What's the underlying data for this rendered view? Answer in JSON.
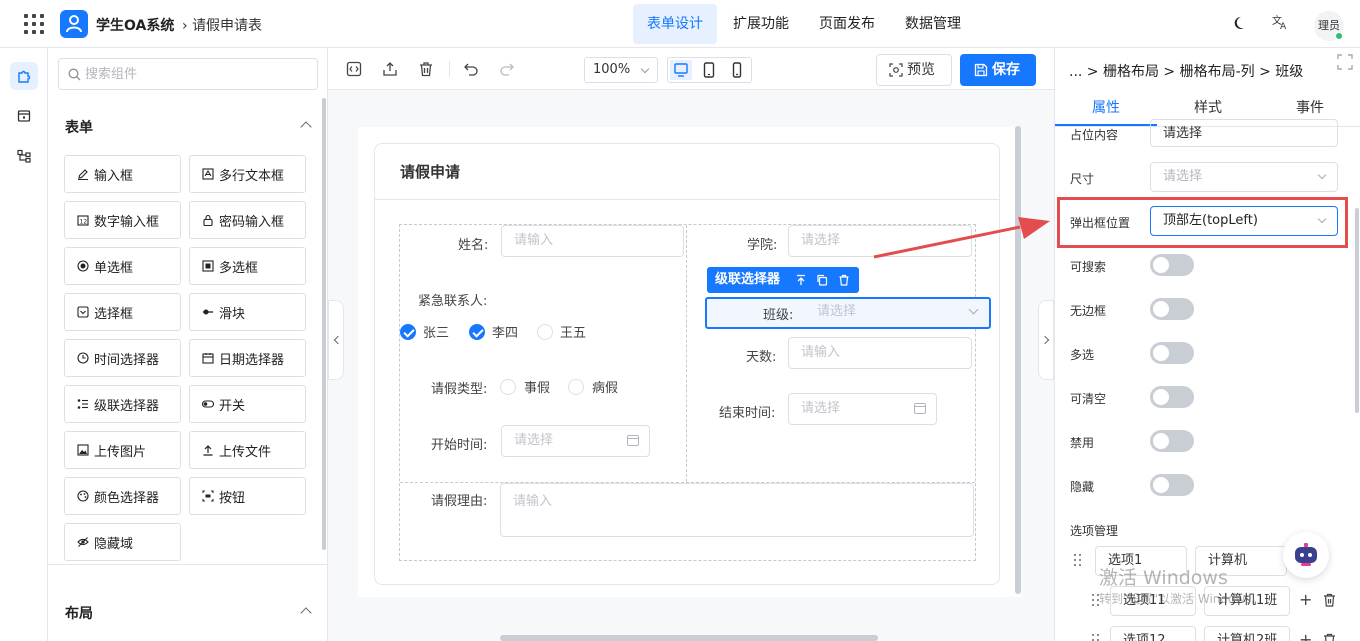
{
  "header": {
    "app_name": "学生OA系统",
    "breadcrumb": "请假申请表",
    "nav": [
      "表单设计",
      "扩展功能",
      "页面发布",
      "数据管理"
    ],
    "active_nav": "表单设计",
    "lang_icon": "文A",
    "avatar_text": "理员"
  },
  "left_rail": [
    "components",
    "form-settings",
    "tree"
  ],
  "components": {
    "search_placeholder": "搜索组件",
    "form_section": "表单",
    "layout_section": "布局",
    "items": [
      {
        "label": "输入框",
        "icon": "pencil-icon"
      },
      {
        "label": "多行文本框",
        "icon": "textarea-icon"
      },
      {
        "label": "数字输入框",
        "icon": "number-icon"
      },
      {
        "label": "密码输入框",
        "icon": "lock-icon"
      },
      {
        "label": "单选框",
        "icon": "radio-icon"
      },
      {
        "label": "多选框",
        "icon": "checkbox-icon"
      },
      {
        "label": "选择框",
        "icon": "select-icon"
      },
      {
        "label": "滑块",
        "icon": "slider-icon"
      },
      {
        "label": "时间选择器",
        "icon": "clock-icon"
      },
      {
        "label": "日期选择器",
        "icon": "calendar-icon"
      },
      {
        "label": "级联选择器",
        "icon": "cascader-icon"
      },
      {
        "label": "开关",
        "icon": "switch-icon"
      },
      {
        "label": "上传图片",
        "icon": "image-icon"
      },
      {
        "label": "上传文件",
        "icon": "upload-icon"
      },
      {
        "label": "颜色选择器",
        "icon": "palette-icon"
      },
      {
        "label": "按钮",
        "icon": "button-icon"
      },
      {
        "label": "隐藏域",
        "icon": "eye-off-icon"
      }
    ]
  },
  "toolbar": {
    "zoom": "100%",
    "preview_label": "预览",
    "save_label": "保存"
  },
  "form": {
    "title": "请假申请",
    "fields": {
      "name_label": "姓名:",
      "name_placeholder": "请输入",
      "college_label": "学院:",
      "college_placeholder": "请选择",
      "class_label": "班级:",
      "class_placeholder": "请选择",
      "contact_label": "紧急联系人:",
      "contacts": [
        {
          "label": "张三",
          "checked": true
        },
        {
          "label": "李四",
          "checked": true
        },
        {
          "label": "王五",
          "checked": false
        }
      ],
      "days_label": "天数:",
      "days_placeholder": "请输入",
      "leave_type_label": "请假类型:",
      "leave_types": [
        "事假",
        "病假"
      ],
      "end_time_label": "结束时间:",
      "end_time_placeholder": "请选择",
      "start_time_label": "开始时间:",
      "start_time_placeholder": "请选择",
      "reason_label": "请假理由:",
      "reason_placeholder": "请输入"
    },
    "selected_tag": "级联选择器"
  },
  "props": {
    "breadcrumb": "... > 栅格布局 > 栅格布局-列 > 班级",
    "tabs": [
      "属性",
      "样式",
      "事件"
    ],
    "active_tab": "属性",
    "placeholder_label": "占位内容",
    "placeholder_value": "请选择",
    "size_label": "尺寸",
    "size_placeholder": "请选择",
    "popup_label": "弹出框位置",
    "popup_value": "顶部左(topLeft)",
    "switches": [
      "可搜索",
      "无边框",
      "多选",
      "可清空",
      "禁用",
      "隐藏"
    ],
    "options_label": "选项管理",
    "options": [
      {
        "key": "选项1",
        "value": "计算机"
      },
      {
        "key": "选项11",
        "value": "计算机1班"
      },
      {
        "key": "选项12",
        "value": "计算机2班"
      }
    ]
  },
  "watermark": {
    "line1": "激活 Windows",
    "line2": "转到\"设置\"以激活 Windows。"
  },
  "colors": {
    "accent": "#1677ff",
    "highlight": "#e34d4d"
  }
}
